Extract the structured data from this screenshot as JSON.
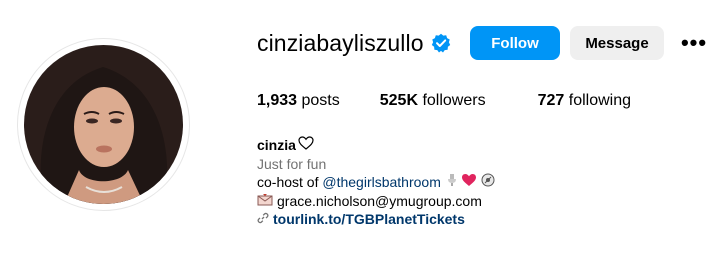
{
  "profile": {
    "username": "cinziabayliszullo",
    "follow_label": "Follow",
    "message_label": "Message",
    "more_label": "•••"
  },
  "stats": {
    "posts_count": "1,933",
    "posts_label": "posts",
    "followers_count": "525K",
    "followers_label": "followers",
    "following_count": "727",
    "following_label": "following"
  },
  "bio": {
    "name": "cinzia",
    "tagline": "Just for fun",
    "cohost_prefix": "co-host of ",
    "cohost_mention": "@thegirlsbathroom",
    "email": "grace.nicholson@ymugroup.com",
    "link": "tourlink.to/TGBPlanetTickets"
  },
  "colors": {
    "follow_bg": "#0095f6",
    "message_bg": "#efefef",
    "verified": "#0095f6",
    "link": "#00376b",
    "secondary_text": "#737373"
  }
}
